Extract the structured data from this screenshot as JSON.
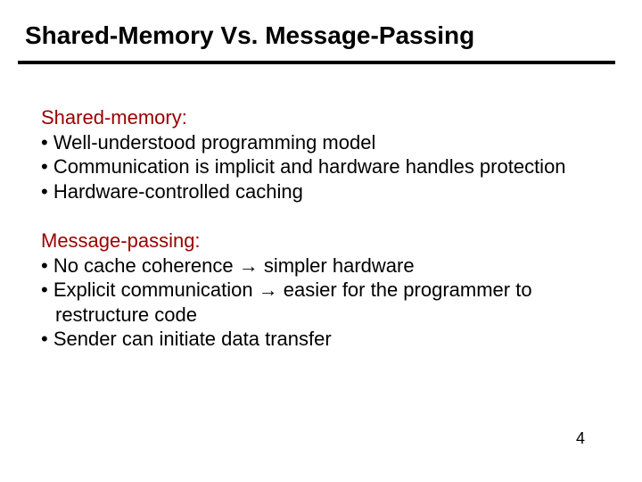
{
  "title": "Shared-Memory Vs. Message-Passing",
  "section1": {
    "heading": "Shared-memory:",
    "b1": "• Well-understood programming model",
    "b2": "• Communication is implicit and hardware handles protection",
    "b3": "• Hardware-controlled caching"
  },
  "section2": {
    "heading": "Message-passing:",
    "b1": "• No cache coherence → simpler hardware",
    "b2": "• Explicit communication → easier for the programmer to",
    "b2cont": "restructure code",
    "b3": "• Sender can initiate data transfer"
  },
  "page": "4"
}
